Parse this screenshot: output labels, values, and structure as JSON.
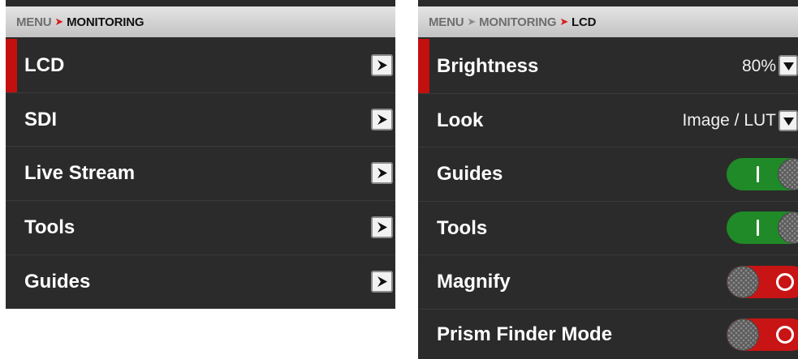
{
  "left": {
    "breadcrumb": {
      "root": "MENU",
      "separator": "➤",
      "current": "MONITORING"
    },
    "items": [
      {
        "label": "LCD",
        "selected": true
      },
      {
        "label": "SDI"
      },
      {
        "label": "Live Stream"
      },
      {
        "label": "Tools"
      },
      {
        "label": "Guides"
      }
    ]
  },
  "right": {
    "breadcrumb": {
      "root": "MENU",
      "mid": "MONITORING",
      "separator": "➤",
      "current": "LCD"
    },
    "brightness": {
      "label": "Brightness",
      "value": "80%"
    },
    "look": {
      "label": "Look",
      "value": "Image / LUT"
    },
    "toggles": [
      {
        "label": "Guides",
        "state": "on"
      },
      {
        "label": "Tools",
        "state": "on"
      },
      {
        "label": "Magnify",
        "state": "off"
      },
      {
        "label": "Prism Finder Mode",
        "state": "off"
      }
    ]
  },
  "colors": {
    "selection": "#c40f0f",
    "toggle_on": "#1f8a27",
    "toggle_off": "#c81414",
    "breadcrumb_arrow_active": "#d81e1e",
    "panel_bg": "#2b2b2b"
  },
  "icons": {
    "nav_arrow": "chevron-right-icon",
    "dropdown": "chevron-down-icon"
  }
}
